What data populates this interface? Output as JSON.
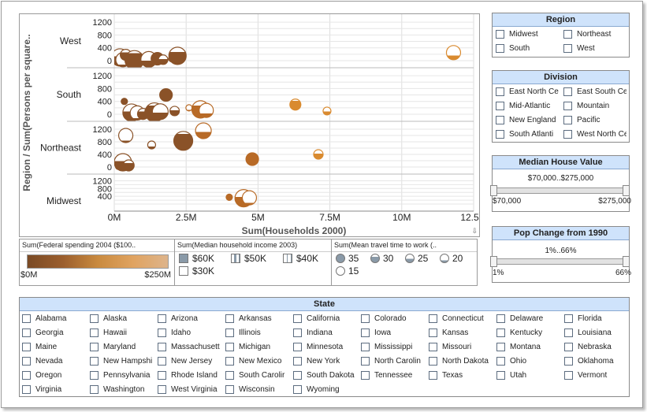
{
  "chart": {
    "y_axis_title": "Region / Sum(Persons per square..",
    "x_axis_title": "Sum(Households 2000)",
    "x_ticks": [
      "0M",
      "2.5M",
      "5M",
      "7.5M",
      "10M",
      "12.5M"
    ],
    "y_ticks": [
      "1200",
      "800",
      "400",
      "0"
    ],
    "midwest_y_ticks": [
      "1200",
      "800",
      "400"
    ],
    "row_labels": [
      "West",
      "South",
      "Northeast",
      "Midwest"
    ]
  },
  "chart_data": {
    "type": "scatter",
    "xlabel": "Sum(Households 2000)",
    "ylabel": "Region / Sum(Persons per square..",
    "xlim": [
      0,
      12500000
    ],
    "ylim": [
      0,
      1300
    ],
    "panels": [
      {
        "name": "West",
        "points": [
          {
            "x": 100000,
            "y": 50
          },
          {
            "x": 200000,
            "y": 100
          },
          {
            "x": 300000,
            "y": 30
          },
          {
            "x": 400000,
            "y": 180
          },
          {
            "x": 500000,
            "y": 80
          },
          {
            "x": 700000,
            "y": 20
          },
          {
            "x": 1200000,
            "y": 40
          },
          {
            "x": 1500000,
            "y": 60
          },
          {
            "x": 1700000,
            "y": 30
          },
          {
            "x": 2000000,
            "y": 60
          },
          {
            "x": 2200000,
            "y": 150
          },
          {
            "x": 11800000,
            "y": 250
          }
        ]
      },
      {
        "name": "South",
        "points": [
          {
            "x": 350000,
            "y": 400
          },
          {
            "x": 600000,
            "y": 50
          },
          {
            "x": 800000,
            "y": 40
          },
          {
            "x": 1000000,
            "y": 10
          },
          {
            "x": 1200000,
            "y": 80
          },
          {
            "x": 1400000,
            "y": 60
          },
          {
            "x": 1600000,
            "y": 80
          },
          {
            "x": 1800000,
            "y": 600
          },
          {
            "x": 2100000,
            "y": 100
          },
          {
            "x": 2600000,
            "y": 200
          },
          {
            "x": 3000000,
            "y": 150
          },
          {
            "x": 3200000,
            "y": 120
          },
          {
            "x": 6300000,
            "y": 300
          },
          {
            "x": 7400000,
            "y": 100
          }
        ]
      },
      {
        "name": "Northeast",
        "points": [
          {
            "x": 150000,
            "y": 20
          },
          {
            "x": 300000,
            "y": 150
          },
          {
            "x": 400000,
            "y": 1000
          },
          {
            "x": 500000,
            "y": 50
          },
          {
            "x": 1300000,
            "y": 700
          },
          {
            "x": 2400000,
            "y": 830
          },
          {
            "x": 3100000,
            "y": 1150
          },
          {
            "x": 4800000,
            "y": 250
          },
          {
            "x": 7100000,
            "y": 400
          }
        ]
      },
      {
        "name": "Midwest",
        "points": [
          {
            "x": 4000000,
            "y": 350
          },
          {
            "x": 4500000,
            "y": 300
          },
          {
            "x": 4700000,
            "y": 320
          }
        ]
      }
    ]
  },
  "legends": {
    "color_title": "Sum(Federal spending 2004 ($100..",
    "color_min": "$0M",
    "color_max": "$250M",
    "income_title": "Sum(Median household income 2003)",
    "income_items": [
      "$60K",
      "$50K",
      "$40K",
      "$30K"
    ],
    "travel_title": "Sum(Mean travel time to work (..",
    "travel_items": [
      "35",
      "30",
      "25",
      "20",
      "15"
    ]
  },
  "region": {
    "title": "Region",
    "items": [
      "Midwest",
      "Northeast",
      "South",
      "West"
    ]
  },
  "division": {
    "title": "Division",
    "items": [
      "East North Ce",
      "East South Ce",
      "Mid-Atlantic",
      "Mountain",
      "New England",
      "Pacific",
      "South Atlanti",
      "West North Ce"
    ]
  },
  "house_value": {
    "title": "Median House Value",
    "range_text": "$70,000..$275,000",
    "min_label": "$70,000",
    "max_label": "$275,000"
  },
  "pop_change": {
    "title": "Pop Change from 1990",
    "range_text": "1%..66%",
    "min_label": "1%",
    "max_label": "66%"
  },
  "state": {
    "title": "State",
    "items": [
      "Alabama",
      "Alaska",
      "Arizona",
      "Arkansas",
      "California",
      "Colorado",
      "Connecticut",
      "Delaware",
      "Florida",
      "Georgia",
      "Hawaii",
      "Idaho",
      "Illinois",
      "Indiana",
      "Iowa",
      "Kansas",
      "Kentucky",
      "Louisiana",
      "Maine",
      "Maryland",
      "Massachusett",
      "Michigan",
      "Minnesota",
      "Mississippi",
      "Missouri",
      "Montana",
      "Nebraska",
      "Nevada",
      "New Hampshi",
      "New Jersey",
      "New Mexico",
      "New York",
      "North Carolin",
      "North Dakota",
      "Ohio",
      "Oklahoma",
      "Oregon",
      "Pennsylvania",
      "Rhode Island",
      "South Carolir",
      "South Dakota",
      "Tennessee",
      "Texas",
      "Utah",
      "Vermont",
      "Virginia",
      "Washington",
      "West Virginia",
      "Wisconsin",
      "Wyoming"
    ]
  }
}
